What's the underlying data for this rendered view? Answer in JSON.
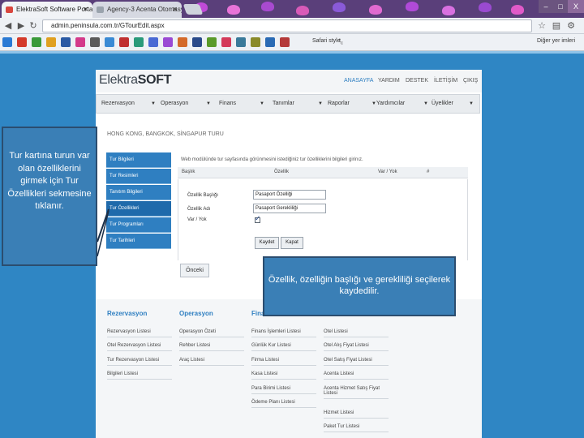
{
  "browser": {
    "tabs": [
      {
        "label": "ElektraSoft Software Porta",
        "active": true
      },
      {
        "label": "Agency-3 Acenta Otomasy",
        "active": false
      }
    ],
    "url": "admin.peninsula.com.tr/GTourEdit.aspx",
    "bookmarks": {
      "safari_style": "Safari style",
      "other": "Diğer yer imleri"
    },
    "window_controls": {
      "minimize": "–",
      "maximize": "□",
      "close": "X"
    }
  },
  "site": {
    "logo_left": "Elektra",
    "logo_right": "SOFT",
    "top_nav": [
      "ANASAYFA",
      "YARDIM",
      "DESTEK",
      "İLETİŞİM",
      "ÇIKIŞ"
    ],
    "menu": [
      "Rezervasyon",
      "Operasyon",
      "Finans",
      "Tanımlar",
      "Raporlar",
      "Yardımcılar",
      "Üyelikler"
    ],
    "page_title": "HONG KONG, BANGKOK, SİNGAPUR TURU",
    "side_nav": [
      "Tur Bilgileri",
      "Tur Resimleri",
      "Tanıtım Bilgileri",
      "Tur Özellikleri",
      "Tur Programları",
      "Tur Tarihleri"
    ],
    "side_nav_active": "Tur Özellikleri",
    "info": "Web modülünde tur sayfasında görünmesini istediğiniz tur özelliklerini bilgileri girinız.",
    "table_headers": [
      "Başlık",
      "Özellik",
      "Var / Yok",
      "#"
    ],
    "form": {
      "baslik_label": "Özellik Başlığı",
      "baslik_value": "Pasaport Özelliği",
      "ad_label": "Özellik Adı",
      "ad_value": "Pasaport Gerekliliği",
      "varyok_label": "Var / Yok",
      "varyok_checked": true,
      "save": "Kaydet",
      "close": "Kapat"
    },
    "back": "Önceki",
    "footer": {
      "columns": [
        {
          "title": "Rezervasyon",
          "links": [
            "Rezervasyon Listesi",
            "Otel Rezervasyon Listesi",
            "Tur Rezervasyon Listesi",
            "Bilgileri Listesi"
          ]
        },
        {
          "title": "Operasyon",
          "links": [
            "Operasyon Özeti",
            "Rehber Listesi",
            "Araç Listesi"
          ]
        },
        {
          "title": "Finans",
          "links": [
            "Finans İşlemleri Listesi",
            "Günlük Kur Listesi",
            "Firma Listesi",
            "Kasa Listesi",
            "Para Birimi Listesi",
            "Ödeme Planı Listesi"
          ]
        },
        {
          "title": "",
          "links": [
            "Otel Listesi",
            "Otel Alış Fiyat Listesi",
            "Otel Satış Fiyat Listesi",
            "Acenta Listesi",
            "Acenta Hizmet Satış Fiyat Listesi",
            "Hizmet Listesi",
            "Paket Tur Listesi"
          ]
        }
      ]
    }
  },
  "callouts": {
    "left": "Tur kartına turun var olan özelliklerini girmek için Tur Özellikleri sekmesine tıklanır.",
    "right": "Özellik, özelliğin başlığı ve gerekliliği seçilerek kaydedilir."
  },
  "colors": {
    "page_bg": "#2f86c4",
    "nav_blue": "#2f7fc1",
    "callout": "#3a7fb6"
  }
}
